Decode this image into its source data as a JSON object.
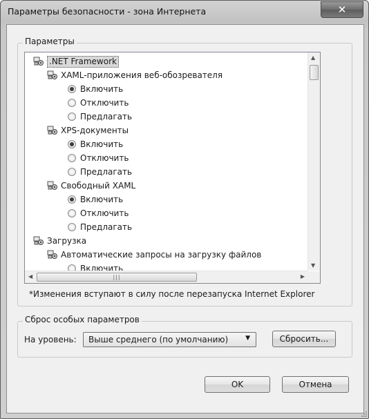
{
  "window": {
    "title": "Параметры безопасности - зона Интернета",
    "close_icon": "close-icon"
  },
  "params_group": {
    "label": "Параметры"
  },
  "tree": [
    {
      "kind": "category",
      "label": ".NET Framework",
      "level": 0,
      "selected": true
    },
    {
      "kind": "setting",
      "label": "XAML-приложения веб-обозревателя",
      "level": 1
    },
    {
      "kind": "radio",
      "label": "Включить",
      "level": 2,
      "checked": true
    },
    {
      "kind": "radio",
      "label": "Отключить",
      "level": 2,
      "checked": false
    },
    {
      "kind": "radio",
      "label": "Предлагать",
      "level": 2,
      "checked": false
    },
    {
      "kind": "setting",
      "label": "XPS-документы",
      "level": 1
    },
    {
      "kind": "radio",
      "label": "Включить",
      "level": 2,
      "checked": true
    },
    {
      "kind": "radio",
      "label": "Отключить",
      "level": 2,
      "checked": false
    },
    {
      "kind": "radio",
      "label": "Предлагать",
      "level": 2,
      "checked": false
    },
    {
      "kind": "setting",
      "label": "Свободный XAML",
      "level": 1
    },
    {
      "kind": "radio",
      "label": "Включить",
      "level": 2,
      "checked": true
    },
    {
      "kind": "radio",
      "label": "Отключить",
      "level": 2,
      "checked": false
    },
    {
      "kind": "radio",
      "label": "Предлагать",
      "level": 2,
      "checked": false
    },
    {
      "kind": "category",
      "label": "Загрузка",
      "level": 0,
      "selected": false
    },
    {
      "kind": "setting",
      "label": "Автоматические запросы на загрузку файлов",
      "level": 1
    },
    {
      "kind": "radio",
      "label": "Включить",
      "level": 2,
      "checked": false
    }
  ],
  "note": "*Изменения вступают в силу после перезапуска Internet Explorer",
  "reset_group": {
    "label": "Сброс особых параметров",
    "level_label": "На уровень:",
    "level_value": "Выше среднего (по умолчанию)",
    "reset_button": "Сбросить..."
  },
  "buttons": {
    "ok": "OK",
    "cancel": "Отмена"
  }
}
